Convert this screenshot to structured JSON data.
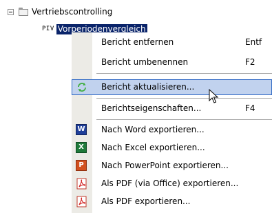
{
  "tree": {
    "folder_label": "Vertriebscontrolling",
    "report_type": "PIV",
    "report_label": "Vorperiodenvergleich"
  },
  "menu": {
    "items": [
      {
        "label": "Bericht entfernen",
        "shortcut": "Entf",
        "icon": ""
      },
      {
        "label": "Bericht umbenennen",
        "shortcut": "F2",
        "icon": ""
      },
      {
        "label": "Bericht aktualisieren...",
        "shortcut": "",
        "icon": "refresh-icon"
      },
      {
        "label": "Berichtseigenschaften...",
        "shortcut": "F4",
        "icon": ""
      },
      {
        "label": "Nach Word exportieren...",
        "shortcut": "",
        "icon": "word-icon"
      },
      {
        "label": "Nach Excel exportieren...",
        "shortcut": "",
        "icon": "excel-icon"
      },
      {
        "label": "Nach PowerPoint exportieren...",
        "shortcut": "",
        "icon": "powerpoint-icon"
      },
      {
        "label": "Als PDF (via Office) exportieren...",
        "shortcut": "",
        "icon": "pdf-icon"
      },
      {
        "label": "Als PDF exportieren...",
        "shortcut": "",
        "icon": "pdf-icon"
      }
    ],
    "hovered_item": "Bericht aktualisieren..."
  },
  "icons": {
    "word_letter": "W",
    "excel_letter": "X",
    "powerpoint_letter": "P"
  },
  "colors": {
    "selection": "#0a246a",
    "hover_bg": "#c1d2ee",
    "hover_border": "#316ac5",
    "icon_column": "#ecebe6"
  }
}
